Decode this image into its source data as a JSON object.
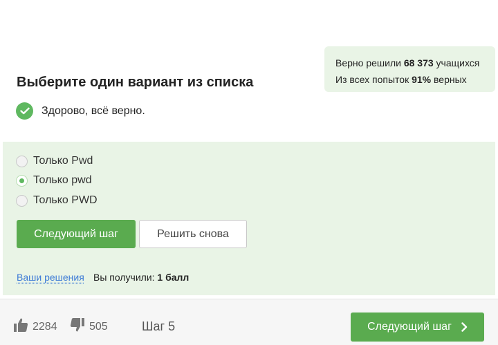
{
  "stats": {
    "solved_prefix": "Верно решили",
    "solved_count": "68 373",
    "solved_suffix": "учащихся",
    "attempts_prefix": "Из всех попыток",
    "attempts_percent": "91%",
    "attempts_suffix": "верных"
  },
  "quiz": {
    "title": "Выберите один вариант из списка",
    "feedback": "Здорово, всё верно.",
    "options": [
      {
        "label": "Только Pwd",
        "checked": false
      },
      {
        "label": "Только pwd",
        "checked": true
      },
      {
        "label": "Только PWD",
        "checked": false
      }
    ],
    "next_label": "Следующий шаг",
    "retry_label": "Решить снова",
    "solutions_link": "Ваши решения",
    "score_prefix": "Вы получили:",
    "score_value": "1 балл"
  },
  "footer": {
    "likes": "2284",
    "dislikes": "505",
    "step": "Шаг 5",
    "next_label": "Следующий шаг"
  },
  "colors": {
    "accent": "#5aab4f",
    "panel": "#e9f4e6",
    "link": "#3d7bd6"
  }
}
